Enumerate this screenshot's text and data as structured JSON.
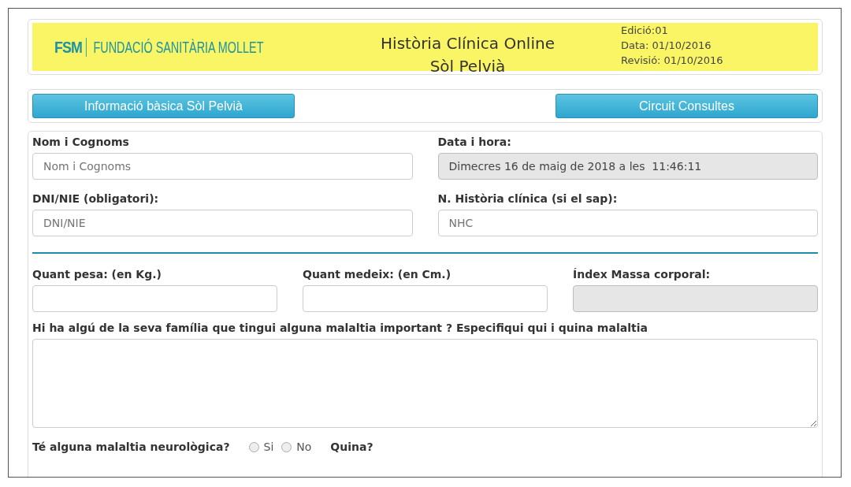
{
  "header": {
    "logo_mark": "FSM",
    "logo_name": "FUNDACIÓ SANITÀRIA MOLLET",
    "title_lines": [
      "Història Clínica Online",
      "Sòl Pelvià"
    ],
    "meta": [
      "Edició:01",
      "Data: 01/10/2016",
      "Revisió: 01/10/2016"
    ]
  },
  "nav_buttons": [
    "Informació bàsica Sòl Pelvià",
    "Circuit Consultes"
  ],
  "identity_fields": [
    {
      "label": "Nom i Cognoms",
      "placeholder": "Nom i Cognoms",
      "disabled": false
    },
    {
      "label": "Data i hora:",
      "value": "Dimecres 16 de maig de 2018 a les  11:46:11",
      "disabled": true
    },
    {
      "label": "DNI/NIE (obligatori):",
      "placeholder": "DNI/NIE",
      "disabled": false
    },
    {
      "label": "N. Història clínica (si el sap):",
      "placeholder": "NHC",
      "disabled": false
    }
  ],
  "body_fields": [
    {
      "label": "Quant pesa: (en Kg.)",
      "disabled": false
    },
    {
      "label": "Quant medeix: (en Cm.)",
      "disabled": false
    },
    {
      "label": "Índex Massa corporal:",
      "disabled": true
    }
  ],
  "family_question": {
    "label": "Hi ha algú de la seva família que tingui alguna malaltia important ? Especifiqui qui i quina malaltia"
  },
  "neuro_question": {
    "label": "Té alguna malaltia neurològica?",
    "options": [
      {
        "label": "Si",
        "selected": false
      },
      {
        "label": "No",
        "selected": false
      }
    ],
    "followup": "Quina?"
  }
}
